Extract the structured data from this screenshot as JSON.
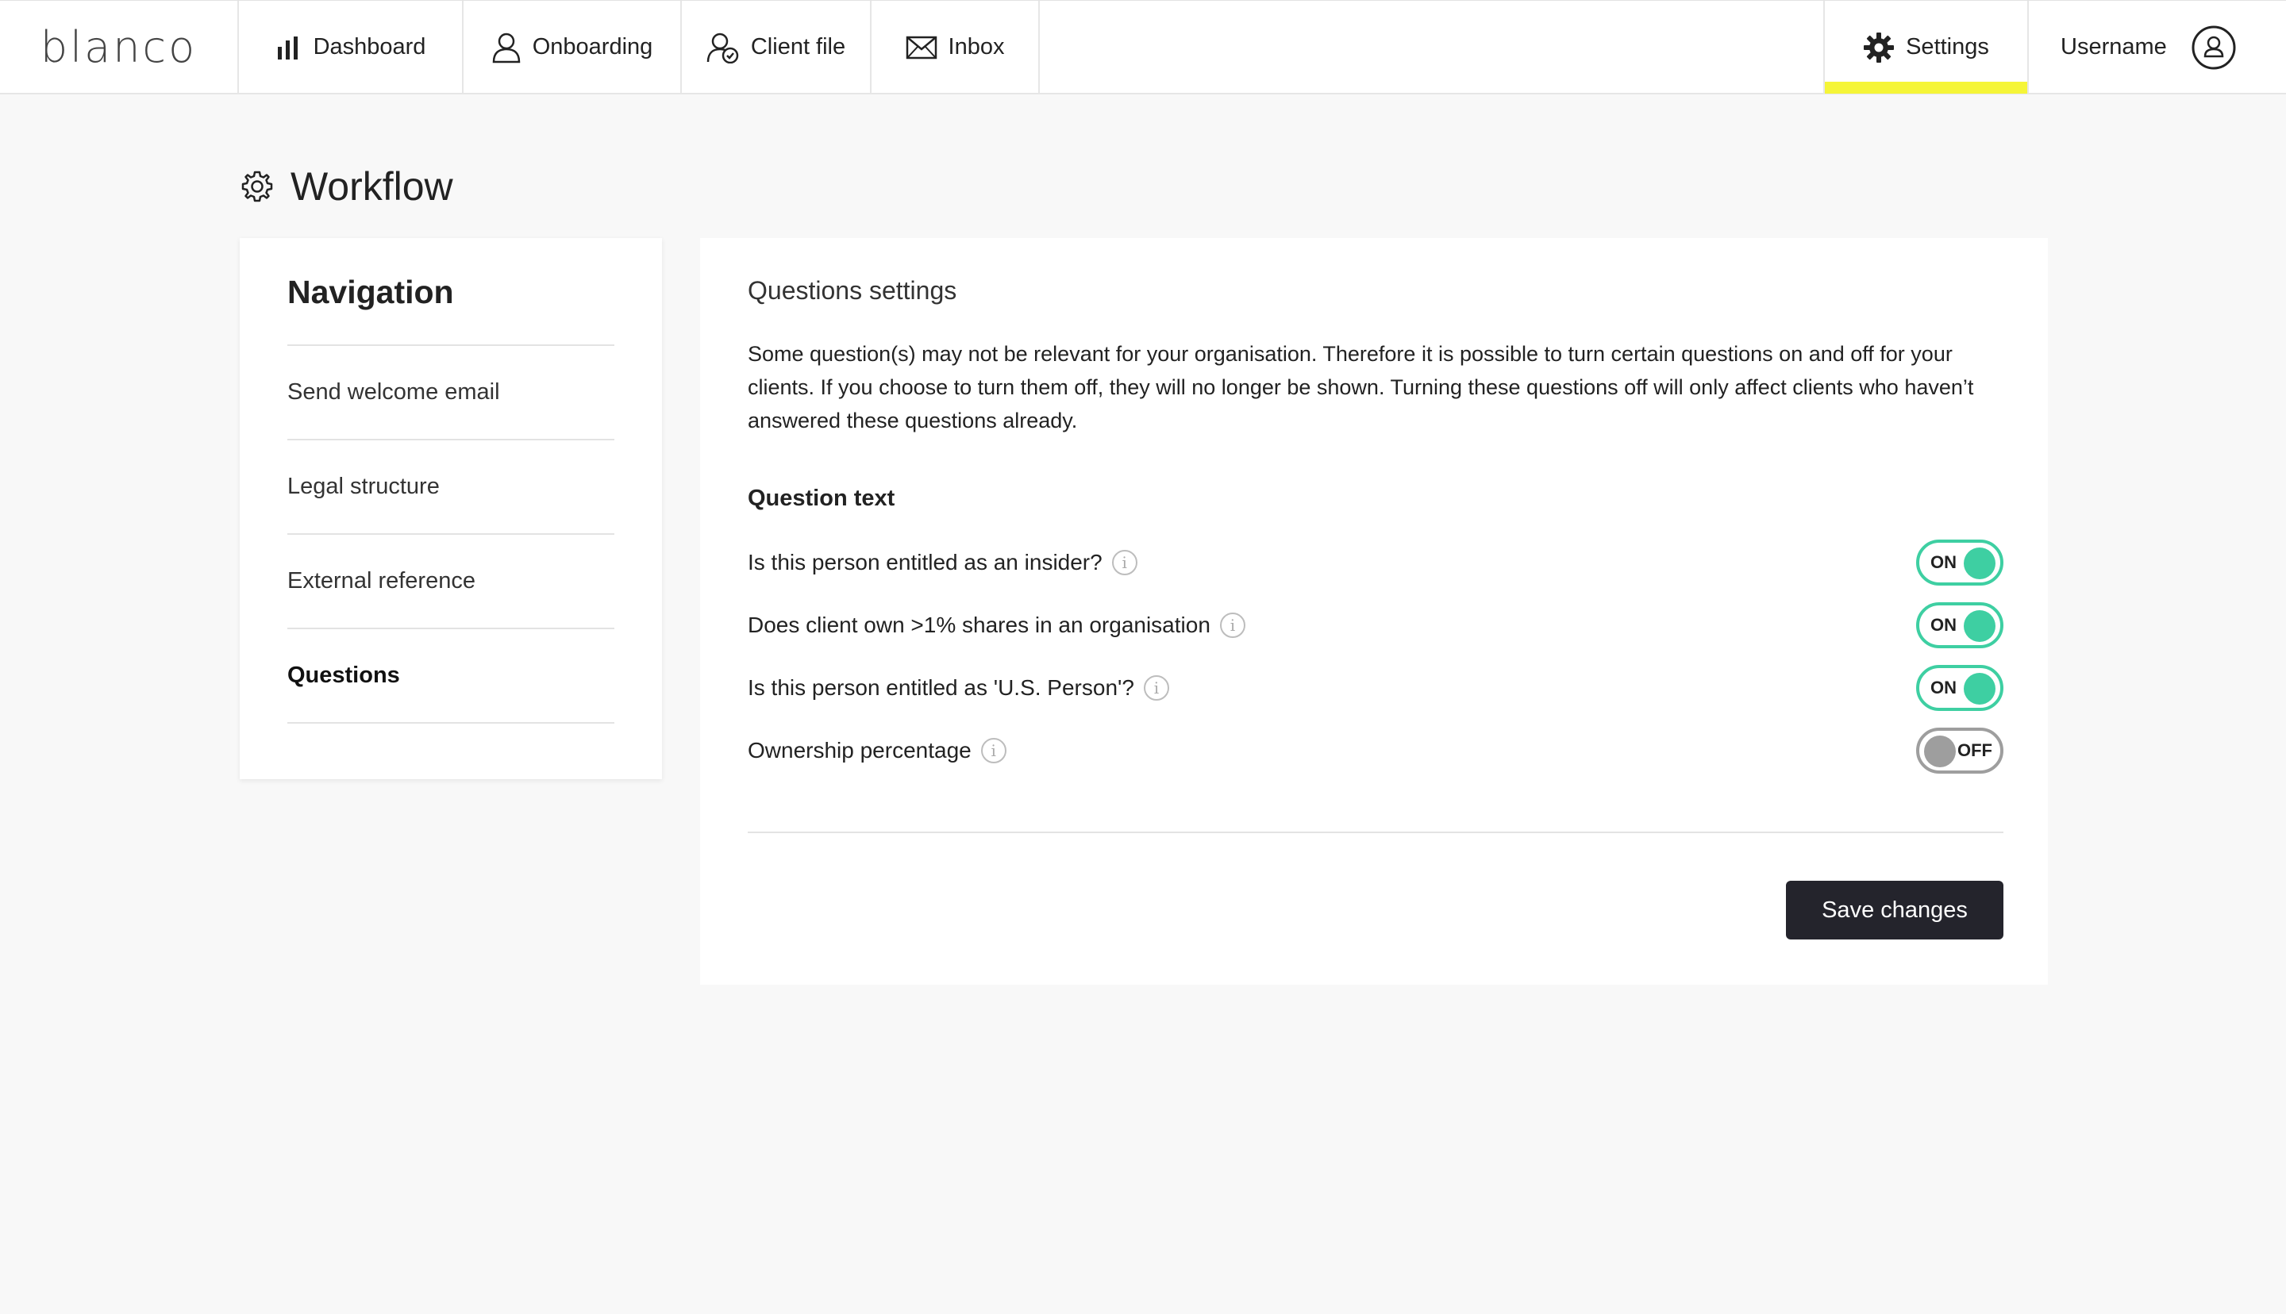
{
  "app": {
    "logo": "blanco"
  },
  "topnav": {
    "dashboard": "Dashboard",
    "onboarding": "Onboarding",
    "client_file": "Client file",
    "inbox": "Inbox",
    "settings": "Settings",
    "username": "Username"
  },
  "page": {
    "title": "Workflow"
  },
  "navigation": {
    "title": "Navigation",
    "items": [
      {
        "label": "Send welcome email",
        "active": false
      },
      {
        "label": "Legal structure",
        "active": false
      },
      {
        "label": "External reference",
        "active": false
      },
      {
        "label": "Questions",
        "active": true
      }
    ]
  },
  "questions": {
    "section_title": "Questions settings",
    "description": "Some question(s) may not be relevant for your organisation. Therefore it is possible to turn certain questions on and off for your clients. If you choose to turn them off, they will no longer be shown. Turning these questions off will only affect clients who haven’t answered these questions already.",
    "column_header": "Question text",
    "items": [
      {
        "label": "Is this person entitled as an insider?",
        "state": "ON"
      },
      {
        "label": "Does client own >1% shares in an organisation",
        "state": "ON"
      },
      {
        "label": "Is this person entitled as 'U.S. Person'?",
        "state": "ON"
      },
      {
        "label": "Ownership percentage",
        "state": "OFF"
      }
    ],
    "save_label": "Save changes"
  },
  "colors": {
    "toggle_on": "#3ecfa2",
    "toggle_off": "#9e9e9e",
    "active_tab_underline": "#f5f538",
    "primary_button": "#24242c"
  }
}
